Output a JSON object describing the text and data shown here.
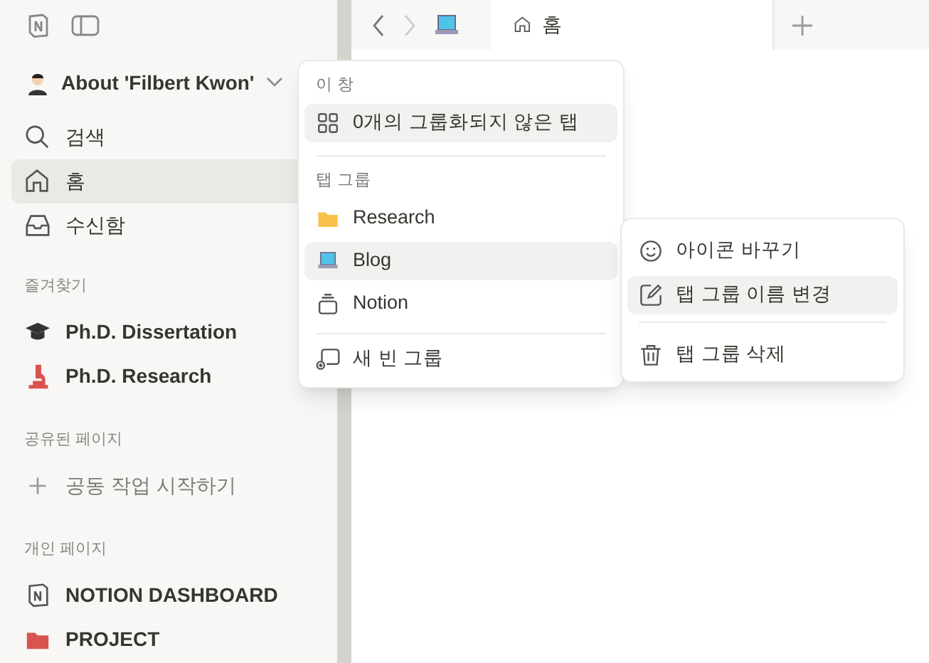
{
  "sidebar": {
    "workspace": {
      "name": "About 'Filbert Kwon'"
    },
    "nav": [
      {
        "label": "검색",
        "kind": "search",
        "selected": false
      },
      {
        "label": "홈",
        "kind": "home",
        "selected": true
      },
      {
        "label": "수신함",
        "kind": "inbox",
        "selected": false
      }
    ],
    "sections": [
      {
        "title": "즐겨찾기",
        "items": [
          {
            "label": "Ph.D. Dissertation",
            "kind": "cap"
          },
          {
            "label": "Ph.D. Research",
            "kind": "microscope"
          }
        ]
      },
      {
        "title": "공유된 페이지",
        "items": [
          {
            "label": "공동 작업 시작하기",
            "kind": "add",
            "muted": true
          }
        ]
      },
      {
        "title": "개인 페이지",
        "items": [
          {
            "label": "NOTION DASHBOARD",
            "kind": "notion"
          },
          {
            "label": "PROJECT",
            "kind": "project"
          }
        ]
      }
    ]
  },
  "tabbar": {
    "tabs": [
      {
        "label": "홈",
        "selected": true
      }
    ]
  },
  "tab_menu": {
    "sections": [
      {
        "title": "이 창",
        "items": [
          {
            "label": "0개의 그룹화되지 않은 탭",
            "kind": "grid",
            "selected": true
          }
        ]
      },
      {
        "title": "탭 그룹",
        "items": [
          {
            "label": "Research",
            "kind": "folder",
            "selected": false
          },
          {
            "label": "Blog",
            "kind": "laptop",
            "selected": true
          },
          {
            "label": "Notion",
            "kind": "stack",
            "selected": false
          }
        ]
      }
    ],
    "action": {
      "label": "새 빈 그룹"
    }
  },
  "context_menu": {
    "groups": [
      {
        "items": [
          {
            "label": "아이콘 바꾸기",
            "kind": "smile",
            "selected": false
          },
          {
            "label": "탭 그룹 이름 변경",
            "kind": "edit",
            "selected": true
          }
        ]
      },
      {
        "items": [
          {
            "label": "탭 그룹 삭제",
            "kind": "trash",
            "selected": false
          }
        ]
      }
    ]
  }
}
